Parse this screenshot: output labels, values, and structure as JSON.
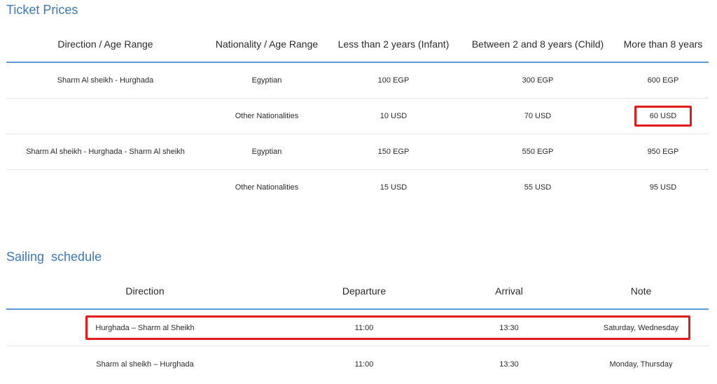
{
  "ticket_prices": {
    "title": "Ticket Prices",
    "headers": [
      "Direction / Age Range",
      "Nationality / Age Range",
      "Less than 2 years (Infant)",
      "Between 2 and 8 years (Child)",
      "More than 8 years"
    ],
    "rows": [
      [
        "Sharm Al sheikh - Hurghada",
        "Egyptian",
        "100 EGP",
        "300 EGP",
        "600 EGP"
      ],
      [
        "",
        "Other Nationalities",
        "10 USD",
        "70 USD",
        "60 USD"
      ],
      [
        "Sharm Al sheikh - Hurghada - Sharm Al sheikh",
        "Egyptian",
        "150 EGP",
        "550 EGP",
        "950 EGP"
      ],
      [
        "",
        "Other Nationalities",
        "15 USD",
        "55 USD",
        "95 USD"
      ]
    ],
    "highlight_color": "#e01b1b"
  },
  "sailing_schedule": {
    "title": "Sailing  schedule",
    "headers": [
      "Direction",
      "Departure",
      "Arrival",
      "Note"
    ],
    "rows": [
      [
        "Hurghada – Sharm al Sheikh",
        "11:00",
        "13:30",
        "Saturday, Wednesday"
      ],
      [
        "Sharm al sheikh – Hurghada",
        "11:00",
        "13:30",
        "Monday, Thursday"
      ]
    ]
  },
  "colors": {
    "title": "#3b79b4",
    "header_rule": "#5b9bd5",
    "row_divider": "#e4e4e4"
  }
}
